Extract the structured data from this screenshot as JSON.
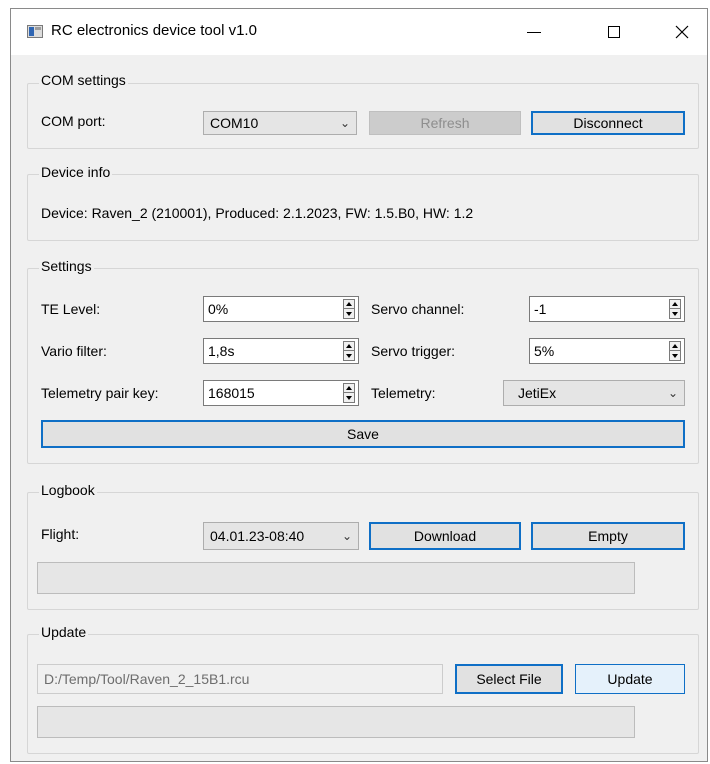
{
  "window": {
    "title": "RC electronics device tool v1.0"
  },
  "com_settings": {
    "group_title": "COM settings",
    "port_label": "COM port:",
    "port_value": "COM10",
    "refresh_label": "Refresh",
    "disconnect_label": "Disconnect"
  },
  "device_info": {
    "group_title": "Device info",
    "text": "Device: Raven_2 (210001), Produced: 2.1.2023, FW: 1.5.B0, HW: 1.2"
  },
  "settings": {
    "group_title": "Settings",
    "te_level_label": "TE Level:",
    "te_level_value": "0%",
    "vario_filter_label": "Vario filter:",
    "vario_filter_value": "1,8s",
    "pair_key_label": "Telemetry pair key:",
    "pair_key_value": "168015",
    "servo_channel_label": "Servo channel:",
    "servo_channel_value": "-1",
    "servo_trigger_label": "Servo trigger:",
    "servo_trigger_value": "5%",
    "telemetry_label": "Telemetry:",
    "telemetry_value": "JetiEx",
    "save_label": "Save"
  },
  "logbook": {
    "group_title": "Logbook",
    "flight_label": "Flight:",
    "flight_value": "04.01.23-08:40",
    "download_label": "Download",
    "empty_label": "Empty",
    "progress": 0
  },
  "update": {
    "group_title": "Update",
    "file_path": "D:/Temp/Tool/Raven_2_15B1.rcu",
    "select_file_label": "Select File",
    "update_label": "Update",
    "progress": 0
  }
}
